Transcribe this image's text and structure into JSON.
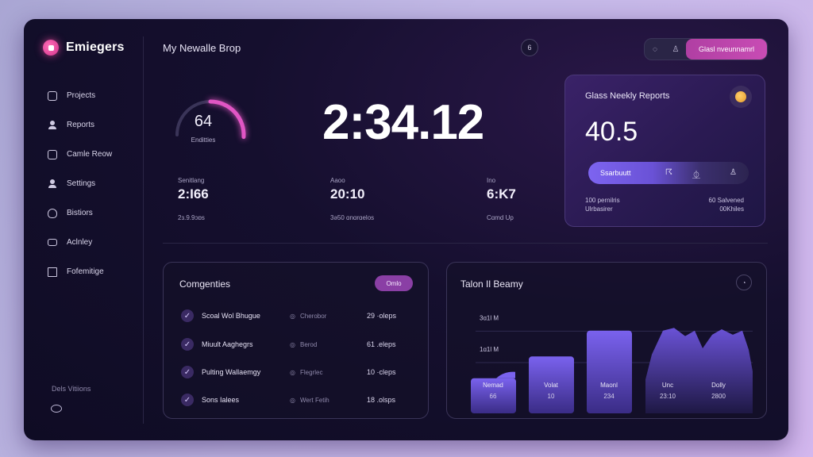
{
  "brand": {
    "name": "Emiegers"
  },
  "sidebar": {
    "items": [
      {
        "label": "Projects",
        "icon": "folder-icon"
      },
      {
        "label": "Reports",
        "icon": "user-icon"
      },
      {
        "label": "Camle Reow",
        "icon": "image-icon"
      },
      {
        "label": "Settings",
        "icon": "user-icon"
      },
      {
        "label": "Bistiors",
        "icon": "shield-icon"
      },
      {
        "label": "Aclnley",
        "icon": "monitor-icon"
      },
      {
        "label": "Fofemitige",
        "icon": "document-icon"
      }
    ],
    "footer_label": "Dels Vitiions"
  },
  "header": {
    "title": "My Newalle Brop",
    "center_icon": "6",
    "cta_label": "Glasl nveunnamrl"
  },
  "gauge": {
    "value": "64",
    "label": "Enditties",
    "fraction": 0.5
  },
  "timer": "2:34.12",
  "stats": [
    {
      "label": "Senitlang",
      "value": "2:I66",
      "sub": "2ɜ.9.9ɔɒs"
    },
    {
      "label": "Aaoo",
      "value": "20:10",
      "sub": "3ǝ50 ɑnɑrɑelos"
    },
    {
      "label": "Ino",
      "value": "6:K7",
      "sub": "Cɑmd Up"
    }
  ],
  "weekly": {
    "title": "Glass Neekly Reports",
    "value": "40.5",
    "pill_label": "Ssarbuutt",
    "meta_left": [
      "100 pernilris",
      "Ulrbasirer"
    ],
    "meta_right": [
      "60 Salvened",
      "00Khiles"
    ]
  },
  "categories": {
    "title": "Comgenties",
    "button_label": "Omlo",
    "rows": [
      {
        "name": "Scoal Wol Bhugue",
        "tag": "Cherobor",
        "num": "29 ·oleps"
      },
      {
        "name": "Miuult Aaghegrs",
        "tag": "Berod",
        "num": "61 .eleps"
      },
      {
        "name": "Pulting Wallaemgy",
        "tag": "Flegrlec",
        "num": "10 ·cleps"
      },
      {
        "name": "Sons Ialees",
        "tag": "Wert Fetih",
        "num": "18 .olsps"
      }
    ]
  },
  "chart_panel": {
    "title": "Talon Il Beamy"
  },
  "chart_data": {
    "type": "bar",
    "title": "Talon Il Beamy",
    "y_tick_labels": [
      "3ɑ1l M",
      "1ɑ1l M"
    ],
    "categories": [
      "Nemad",
      "Volat",
      "Maonl",
      "Unc",
      "Dolly"
    ],
    "sub_labels": [
      "66",
      "10",
      "234",
      "23:10",
      "2800"
    ],
    "values": [
      40,
      72,
      110,
      88,
      85
    ],
    "ylim": [
      0,
      140
    ],
    "area_series": true,
    "colors": {
      "bar": "#6a52d6",
      "area": "#4b3a9a"
    }
  }
}
